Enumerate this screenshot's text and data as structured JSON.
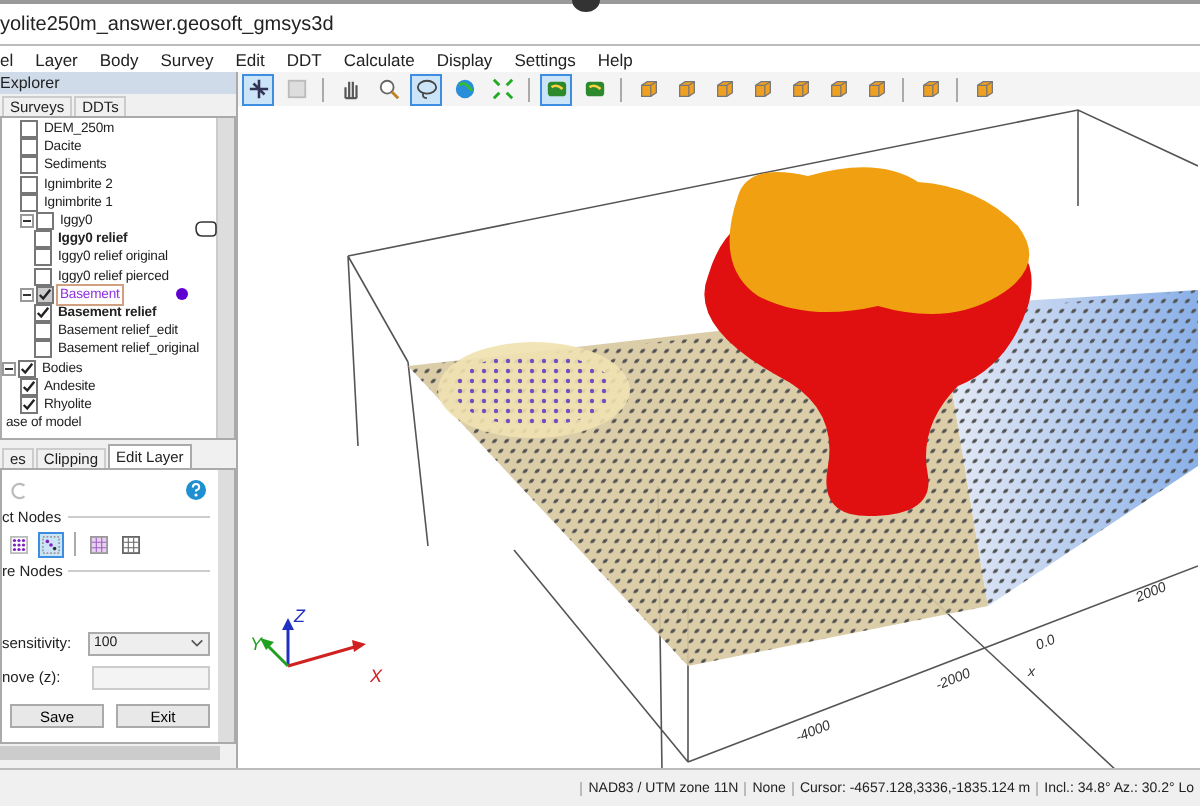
{
  "window": {
    "title": "yolite250m_answer.geosoft_gmsys3d"
  },
  "menu": [
    "el",
    "Layer",
    "Body",
    "Survey",
    "Edit",
    "DDT",
    "Calculate",
    "Display",
    "Settings",
    "Help"
  ],
  "toolbar": [
    {
      "kind": "pointer",
      "selected": true
    },
    {
      "kind": "blank",
      "selected": false
    },
    {
      "kind": "sep"
    },
    {
      "kind": "hand",
      "selected": false
    },
    {
      "kind": "zoom",
      "selected": false
    },
    {
      "kind": "lasso",
      "selected": true
    },
    {
      "kind": "globe",
      "selected": false
    },
    {
      "kind": "fit",
      "selected": false
    },
    {
      "kind": "sep"
    },
    {
      "kind": "tile",
      "selected": true
    },
    {
      "kind": "tile",
      "selected": false
    },
    {
      "kind": "sep"
    },
    {
      "kind": "cube",
      "selected": false
    },
    {
      "kind": "cube",
      "selected": false
    },
    {
      "kind": "cube",
      "selected": false
    },
    {
      "kind": "cube",
      "selected": false
    },
    {
      "kind": "cube",
      "selected": false
    },
    {
      "kind": "cube",
      "selected": false
    },
    {
      "kind": "cube",
      "selected": false
    },
    {
      "kind": "sep"
    },
    {
      "kind": "cube",
      "selected": false
    },
    {
      "kind": "sep"
    },
    {
      "kind": "cube",
      "selected": false
    }
  ],
  "explorer": {
    "title": "Explorer",
    "tabs": [
      {
        "label": "Surveys",
        "selected": false
      },
      {
        "label": "DDTs",
        "selected": false
      }
    ],
    "tree": [
      {
        "kind": "layer",
        "label": "DEM_250m",
        "checked": false,
        "selected": false
      },
      {
        "kind": "layer",
        "label": "Dacite",
        "checked": false,
        "selected": false
      },
      {
        "kind": "layer",
        "label": "Sediments",
        "checked": false,
        "selected": false
      },
      {
        "kind": "layer",
        "label": "Ignimbrite 2",
        "checked": false,
        "selected": false
      },
      {
        "kind": "layer",
        "label": "Ignimbrite 1",
        "checked": false,
        "selected": false
      },
      {
        "kind": "layer",
        "label": "Iggy0",
        "checked": false,
        "selected": false,
        "expanded": true,
        "children": [
          {
            "label": "Iggy0 relief",
            "checked": false,
            "selected": false,
            "active": true
          },
          {
            "label": "Iggy0 relief original",
            "checked": false,
            "selected": false
          },
          {
            "label": "Iggy0 relief pierced",
            "checked": false,
            "selected": false
          }
        ]
      },
      {
        "kind": "layer",
        "label": "Basement",
        "checked": true,
        "partial": true,
        "selected": true,
        "expanded": true,
        "color": "#6000d0",
        "children": [
          {
            "label": "Basement relief",
            "checked": true,
            "selected": false,
            "active": true
          },
          {
            "label": "Basement relief_edit",
            "checked": false,
            "selected": false
          },
          {
            "label": "Basement relief_original",
            "checked": false,
            "selected": false
          }
        ]
      },
      {
        "kind": "group",
        "label": "Bodies",
        "checked": true,
        "selected": false,
        "expanded": true,
        "children": [
          {
            "label": "Andesite",
            "checked": true,
            "selected": false
          },
          {
            "label": "Rhyolite",
            "checked": true,
            "selected": false
          }
        ]
      },
      {
        "kind": "label",
        "label": "ase of model",
        "selected": false
      }
    ]
  },
  "edit_panel": {
    "tabs": [
      {
        "label": "es",
        "selected": false
      },
      {
        "label": "Clipping",
        "selected": false
      },
      {
        "label": "Edit Layer",
        "selected": true
      }
    ],
    "undo_disabled": true,
    "select_heading": "ct Nodes",
    "node_tools": [
      {
        "kind": "dots",
        "selected": false
      },
      {
        "kind": "diag",
        "selected": true
      },
      {
        "kind": "sep"
      },
      {
        "kind": "grid",
        "selected": false
      },
      {
        "kind": "grid2",
        "selected": false
      }
    ],
    "move_heading": "re Nodes",
    "sensitivity": {
      "label": "sensitivity:",
      "value": "100"
    },
    "move": {
      "label": "nove (z):"
    },
    "buttons": [
      "Save",
      "Exit"
    ]
  },
  "viewport": {
    "ticks": [
      "-4000",
      "-2000",
      "0.0",
      "2000"
    ],
    "axis_label": "x",
    "triad": [
      "Z",
      "Y",
      "X"
    ]
  },
  "status_bar": [
    "NAD83 / UTM zone 11N",
    "None",
    "Cursor: -4657.128,3336,-1835.124 m",
    "Incl.: 34.8° Az.: 30.2° Lo"
  ]
}
